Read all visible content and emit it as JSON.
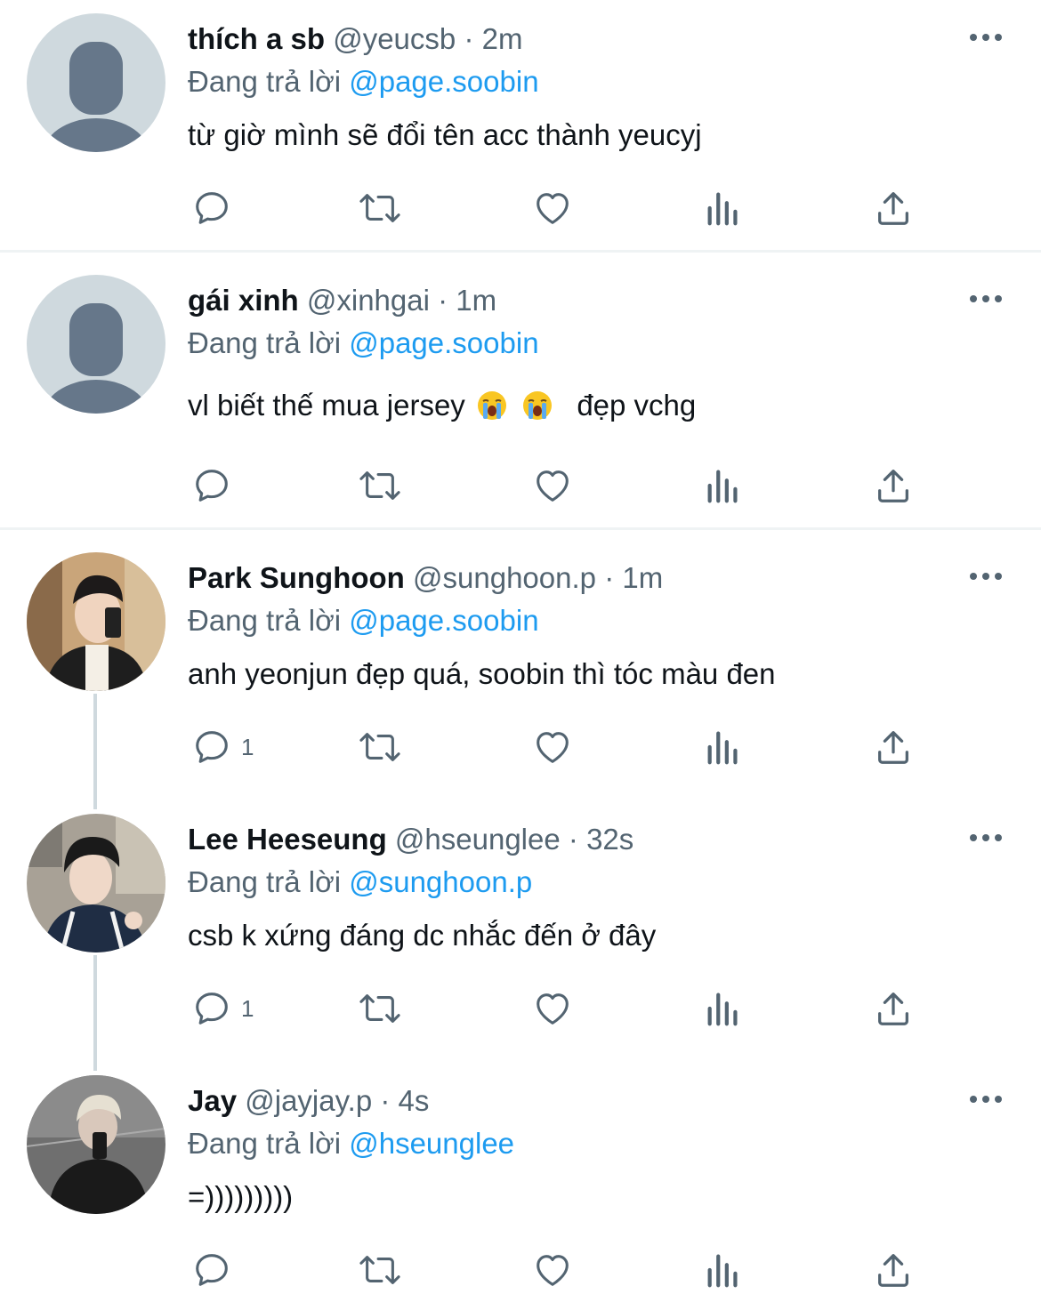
{
  "reply_prefix": "Đang trả lời",
  "colors": {
    "accent": "#1d9bf0",
    "muted": "#536471",
    "text": "#0f1419",
    "divider": "#eff3f4",
    "thread": "#cfd9de"
  },
  "tweets": [
    {
      "name": "thích a sb",
      "handle": "@yeucsb",
      "sep": "·",
      "time": "2m",
      "reply_to": "@page.soobin",
      "text": "từ giờ mình sẽ đổi tên acc thành yeucyj",
      "avatar": "default-avatar",
      "reply_count": ""
    },
    {
      "name": "gái xinh",
      "handle": "@xinhgai",
      "sep": "·",
      "time": "1m",
      "reply_to": "@page.soobin",
      "text_before": "vl biết thế mua jersey",
      "text_after": "đẹp vchg",
      "emoji": "loudly-crying-face-emoji",
      "avatar": "default-avatar",
      "reply_count": ""
    },
    {
      "name": "Park Sunghoon",
      "handle": "@sunghoon.p",
      "sep": "·",
      "time": "1m",
      "reply_to": "@page.soobin",
      "text": "anh yeonjun đẹp quá, soobin thì tóc màu đen",
      "avatar": "photo-avatar",
      "reply_count": "1"
    },
    {
      "name": "Lee Heeseung",
      "handle": "@hseunglee",
      "sep": "·",
      "time": "32s",
      "reply_to": "@sunghoon.p",
      "text": "csb k xứng đáng dc nhắc đến ở đây",
      "avatar": "photo-avatar",
      "reply_count": "1"
    },
    {
      "name": "Jay",
      "handle": "@jayjay.p",
      "sep": "·",
      "time": "4s",
      "reply_to": "@hseunglee",
      "text": "=)))))))))",
      "avatar": "photo-avatar",
      "reply_count": ""
    }
  ],
  "icons": [
    "reply-icon",
    "retweet-icon",
    "like-icon",
    "views-icon",
    "share-icon",
    "more-options-icon"
  ]
}
